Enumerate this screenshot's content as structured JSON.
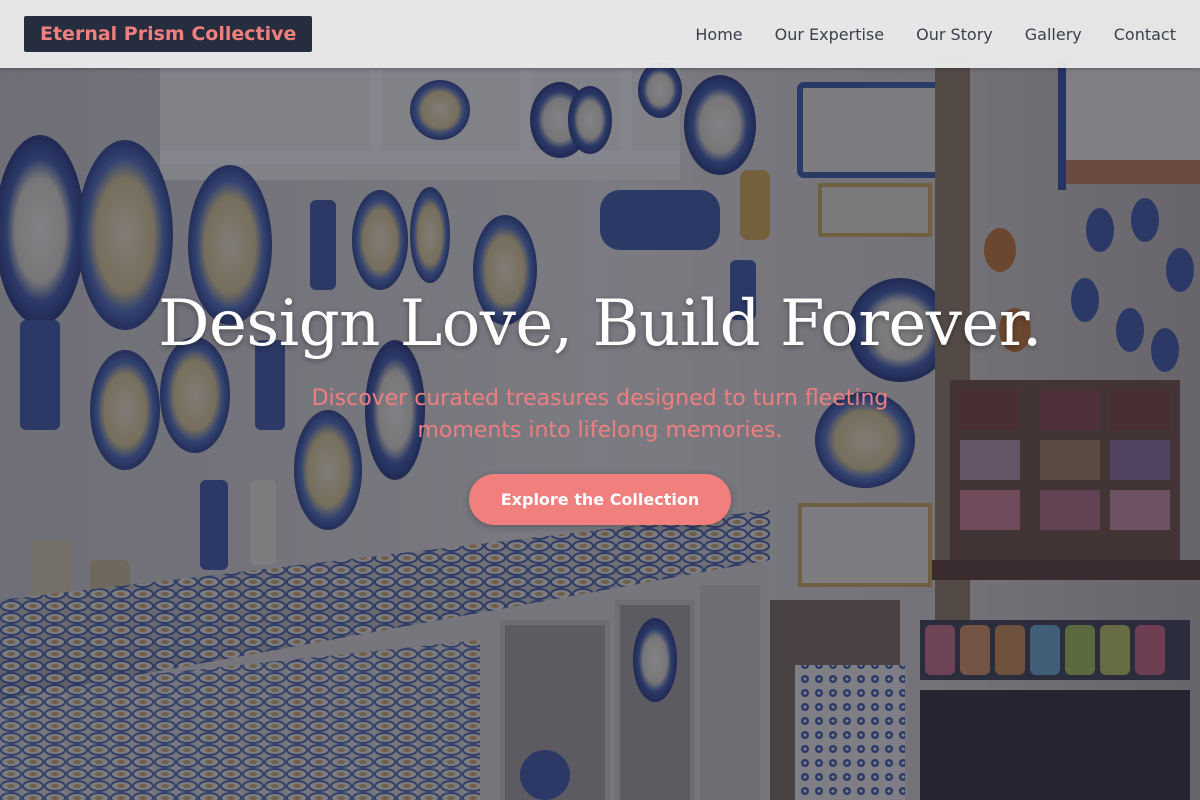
{
  "header": {
    "brand": "Eternal Prism Collective",
    "nav": [
      {
        "label": "Home"
      },
      {
        "label": "Our Expertise"
      },
      {
        "label": "Our Story"
      },
      {
        "label": "Gallery"
      },
      {
        "label": "Contact"
      }
    ]
  },
  "hero": {
    "title": "Design Love, Build Forever.",
    "subtitle": "Discover curated treasures designed to turn fleeting moments into lifelong memories.",
    "cta_label": "Explore the Collection",
    "background_image": "ceramic-shop-shelves-photo"
  },
  "colors": {
    "accent": "#f07f7e",
    "brand_bg": "#262d3f",
    "header_bg": "#ececec",
    "nav_text": "#3a3f4c",
    "title_text": "#ffffff"
  }
}
